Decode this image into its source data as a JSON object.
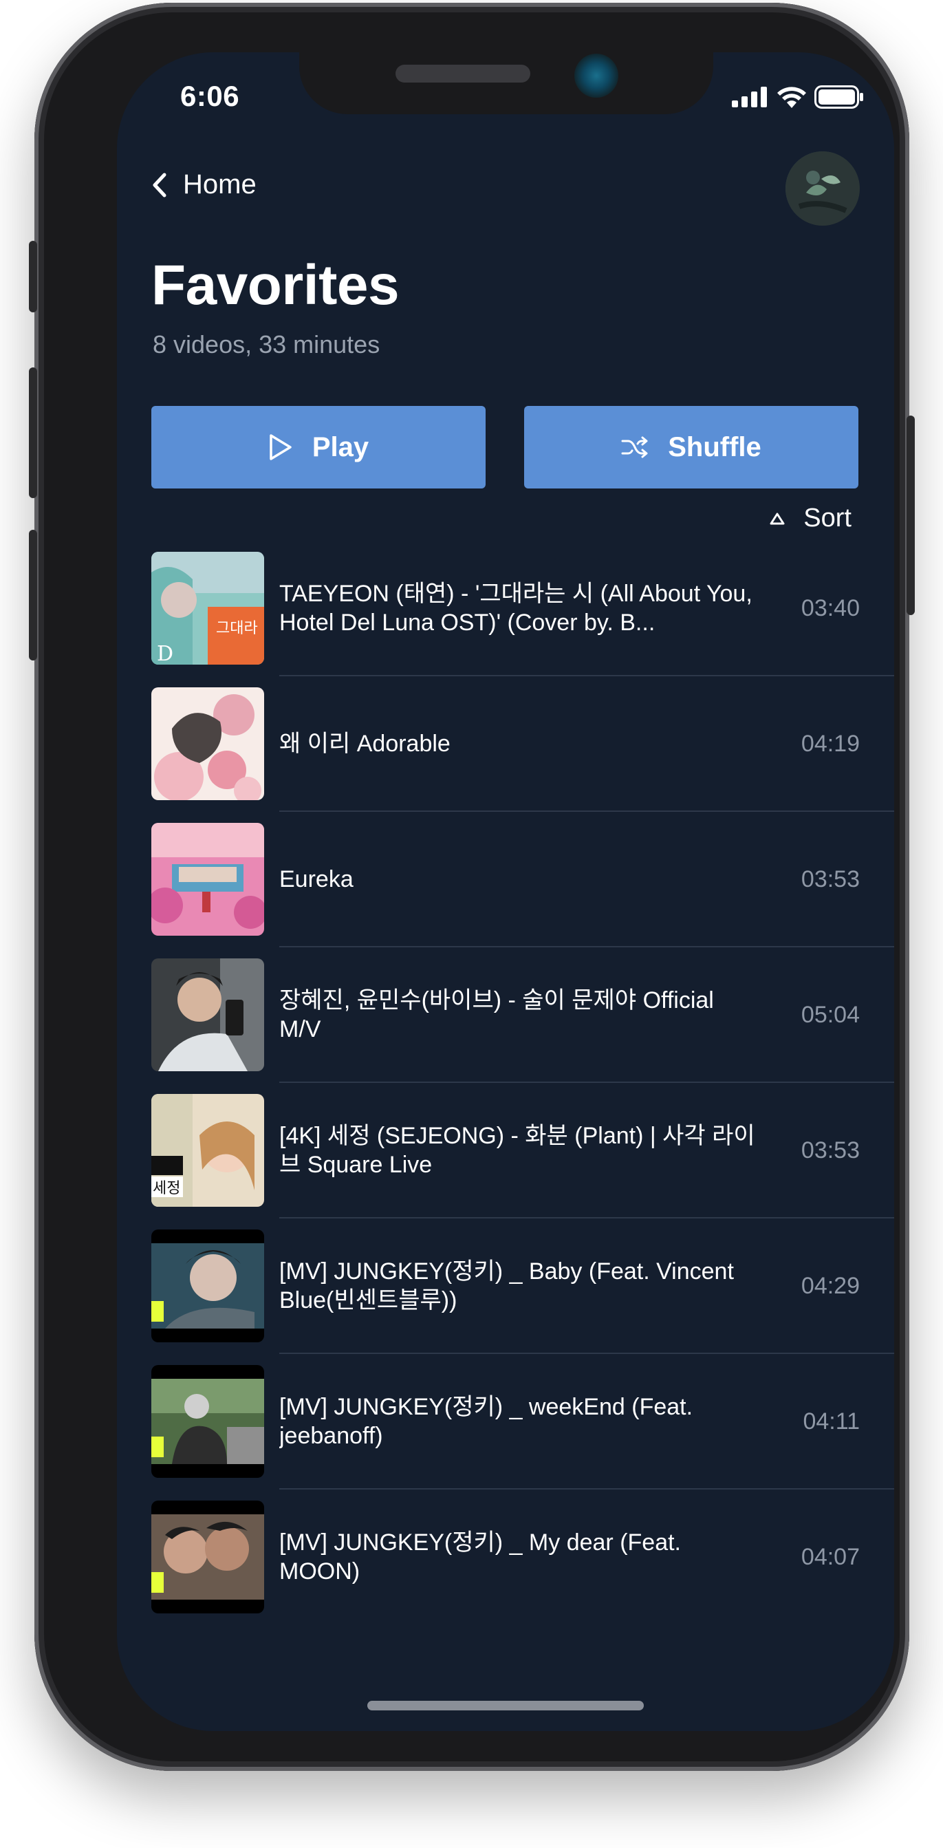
{
  "status_bar": {
    "time": "6:06"
  },
  "header": {
    "back_label": "Home",
    "title": "Favorites",
    "subtitle": "8 videos, 33 minutes"
  },
  "actions": {
    "play_label": "Play",
    "shuffle_label": "Shuffle",
    "sort_label": "Sort"
  },
  "colors": {
    "background": "#141e2e",
    "button": "#5b8fd6",
    "muted_text": "#8f98a6"
  },
  "videos": [
    {
      "title": "TAEYEON (태연) - '그대라는 시 (All About You, Hotel Del Luna OST)' (Cover by. B...",
      "duration": "03:40"
    },
    {
      "title": "왜 이리 Adorable",
      "duration": "04:19"
    },
    {
      "title": "Eureka",
      "duration": "03:53"
    },
    {
      "title": "장혜진, 윤민수(바이브) - 술이 문제야 Official M/V",
      "duration": "05:04"
    },
    {
      "title": "[4K] 세정 (SEJEONG) - 화분 (Plant) | 사각 라이브 Square Live",
      "duration": "03:53"
    },
    {
      "title": "[MV] JUNGKEY(정키) _ Baby (Feat. Vincent Blue(빈센트블루))",
      "duration": "04:29"
    },
    {
      "title": "[MV] JUNGKEY(정키) _ weekEnd (Feat. jeebanoff)",
      "duration": "04:11"
    },
    {
      "title": "[MV] JUNGKEY(정키) _ My dear (Feat. MOON)",
      "duration": "04:07"
    }
  ]
}
